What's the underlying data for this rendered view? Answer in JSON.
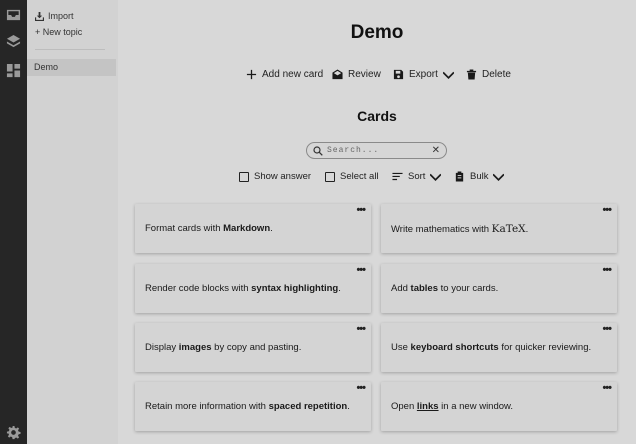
{
  "rail": {
    "icons": [
      "inbox-icon",
      "layers-icon",
      "dashboard-icon",
      "settings-icon"
    ]
  },
  "sidebar": {
    "import_label": "Import",
    "new_topic_label": "+ New topic",
    "topics": [
      "Demo"
    ]
  },
  "main": {
    "title": "Demo",
    "toolbar": {
      "add_label": "Add new card",
      "review_label": "Review",
      "export_label": "Export",
      "delete_label": "Delete"
    },
    "section_title": "Cards",
    "search": {
      "placeholder": "Search...",
      "value": ""
    },
    "filters": {
      "show_answer_label": "Show answer",
      "select_all_label": "Select all",
      "sort_label": "Sort",
      "bulk_label": "Bulk"
    },
    "cards": [
      {
        "menu": "•••",
        "pre": "Format cards with ",
        "bold": "Markdown",
        "post": "."
      },
      {
        "menu": "•••",
        "pre": "Write mathematics with ",
        "bold": "KaTeX",
        "post": "."
      },
      {
        "menu": "•••",
        "pre": "Render code blocks with ",
        "bold": "syntax highlighting",
        "post": "."
      },
      {
        "menu": "•••",
        "pre": "Add ",
        "bold": "tables",
        "post": " to your cards."
      },
      {
        "menu": "•••",
        "pre": "Display ",
        "bold": "images",
        "post": " by copy and pasting."
      },
      {
        "menu": "•••",
        "pre": "Use ",
        "bold": "keyboard shortcuts",
        "post": " for quicker reviewing."
      },
      {
        "menu": "•••",
        "pre": "Retain more information with ",
        "bold": "spaced repetition",
        "post": "."
      },
      {
        "menu": "•••",
        "pre": "Open ",
        "bold": "links",
        "post": " in a new window."
      }
    ]
  }
}
